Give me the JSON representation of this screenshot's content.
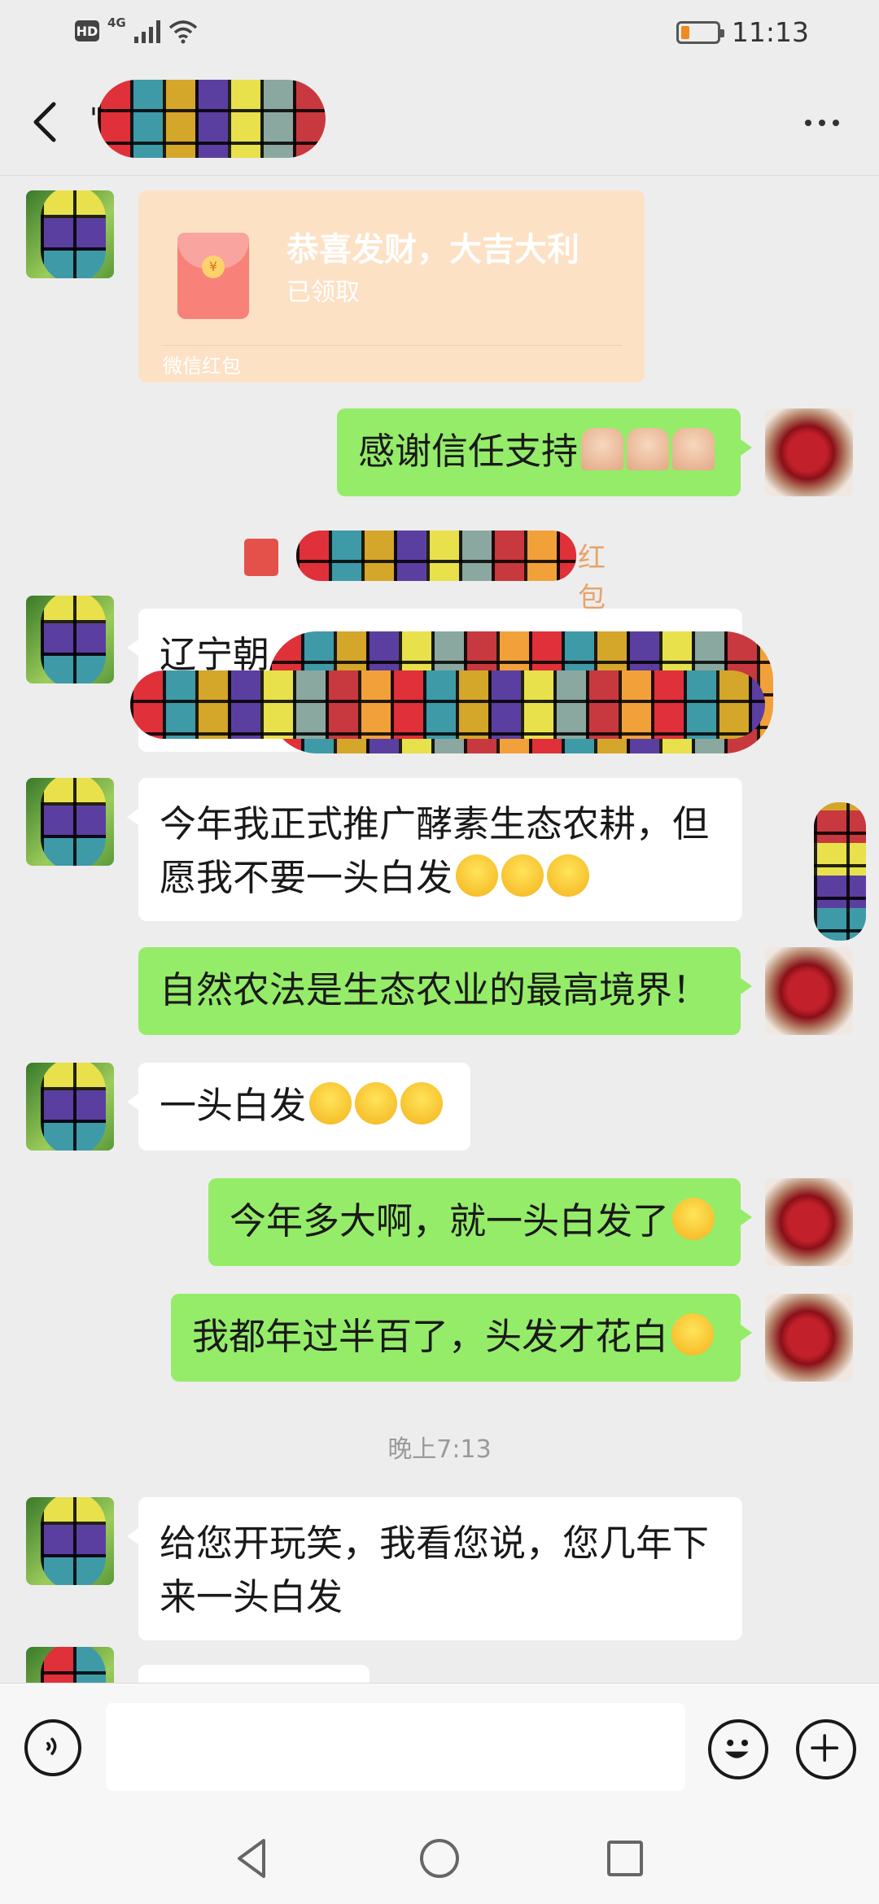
{
  "status_bar": {
    "network": "4G",
    "hd": "HD",
    "time": "11:13",
    "battery_level": 0.2,
    "battery_color": "#f08a1c"
  },
  "header": {
    "title": "\"",
    "back_icon": "chevron-left-icon",
    "more_icon": "more-horizontal-icon"
  },
  "messages": {
    "red_packet": {
      "title": "恭喜发财，大吉大利",
      "status": "已领取",
      "label": "微信红包"
    },
    "m1": "感谢信任支持",
    "system_notice": "红包",
    "m2": "辽宁朝",
    "m3": "今年我正式推广酵素生态农耕，但愿我不要一头白发",
    "m4": "自然农法是生态农业的最高境界！",
    "m5": "一头白发",
    "m6": "今年多大啊，就一头白发了",
    "m7": "我都年过半百了，头发才花白",
    "timestamp": "晚上7:13",
    "m8": "给您开玩笑，我看您说，您几年下来一头白发"
  },
  "input_bar": {
    "value": "",
    "voice_icon": "voice-icon",
    "emoji_icon": "emoji-icon",
    "plus_icon": "plus-icon"
  },
  "colors": {
    "incoming_bubble": "#ffffff",
    "outgoing_bubble": "#95ec69",
    "red_packet_bg": "#fde1c5",
    "background": "#ededed"
  }
}
